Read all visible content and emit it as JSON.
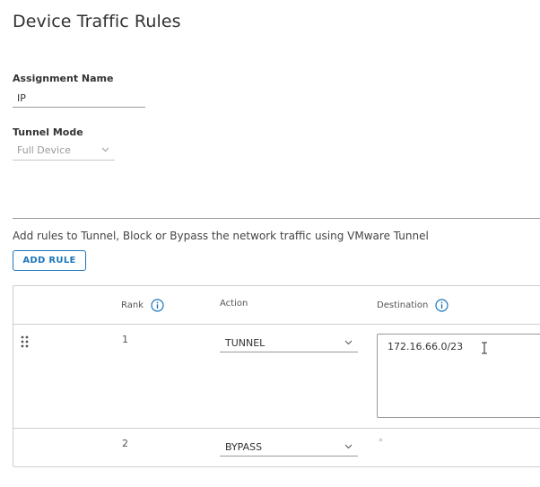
{
  "page": {
    "title": "Device Traffic Rules"
  },
  "assignment": {
    "label": "Assignment Name",
    "value": "IP"
  },
  "tunnel_mode": {
    "label": "Tunnel Mode",
    "selected": "Full Device"
  },
  "help_text": "Add rules to Tunnel, Block or Bypass the network traffic using VMware Tunnel",
  "add_rule_label": "ADD RULE",
  "table": {
    "columns": {
      "rank": "Rank",
      "action": "Action",
      "destination": "Destination"
    },
    "rows": [
      {
        "rank": "1",
        "action": "TUNNEL",
        "destination": "172.16.66.0/23"
      },
      {
        "rank": "2",
        "action": "BYPASS",
        "destination": "*"
      }
    ]
  },
  "colors": {
    "accent": "#1b75bb",
    "border": "#cfcfcf",
    "text": "#333333"
  },
  "icons": [
    "info-icon",
    "chevron-down-icon",
    "drag-handle-icon",
    "text-cursor-icon"
  ]
}
